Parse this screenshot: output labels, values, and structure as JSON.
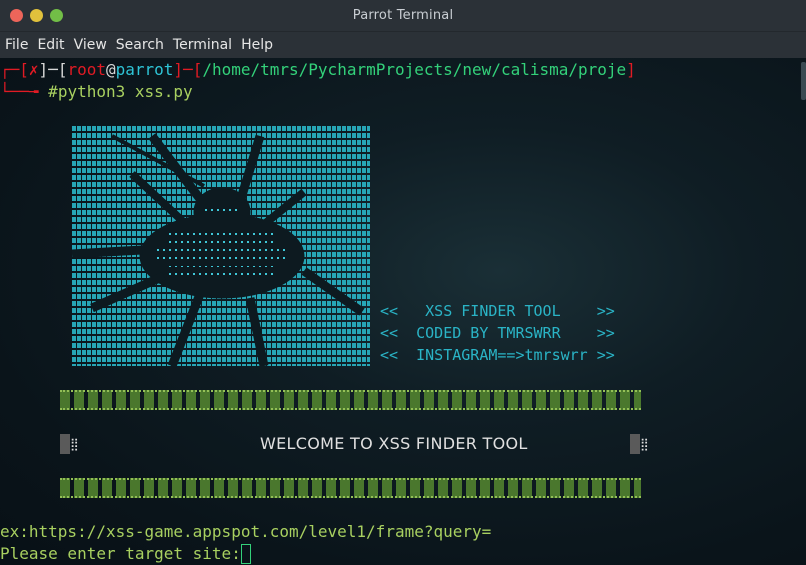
{
  "window": {
    "title": "Parrot Terminal"
  },
  "menu": [
    "File",
    "Edit",
    "View",
    "Search",
    "Terminal",
    "Help"
  ],
  "prompt": {
    "corner": "┌",
    "open_x": "─[",
    "status": "✗",
    "close_x": "]─[",
    "user": "root",
    "at": "@",
    "host": "parrot",
    "sep": "]─[",
    "path": "/home/tmrs/PycharmProjects/new/calisma/proje",
    "bottom_corner": "└──╼ ",
    "hash": "#",
    "command": "python3 xss.py"
  },
  "banner": [
    "<<   XSS FINDER TOOL    >>",
    "<<  CODED BY TMRSWRR    >>",
    "<<  INSTAGRAM==>tmrswrr >>"
  ],
  "welcome": "WELCOME TO XSS FINDER TOOL",
  "example_line": "ex:https://xss-game.appspot.com/level1/frame?query=",
  "input_prompt": "Please enter target site:",
  "colors": {
    "prompt_red": "#e01b24",
    "cyan": "#2ec4d6",
    "green": "#33d17a",
    "bar_green": "#4e7d2e"
  }
}
